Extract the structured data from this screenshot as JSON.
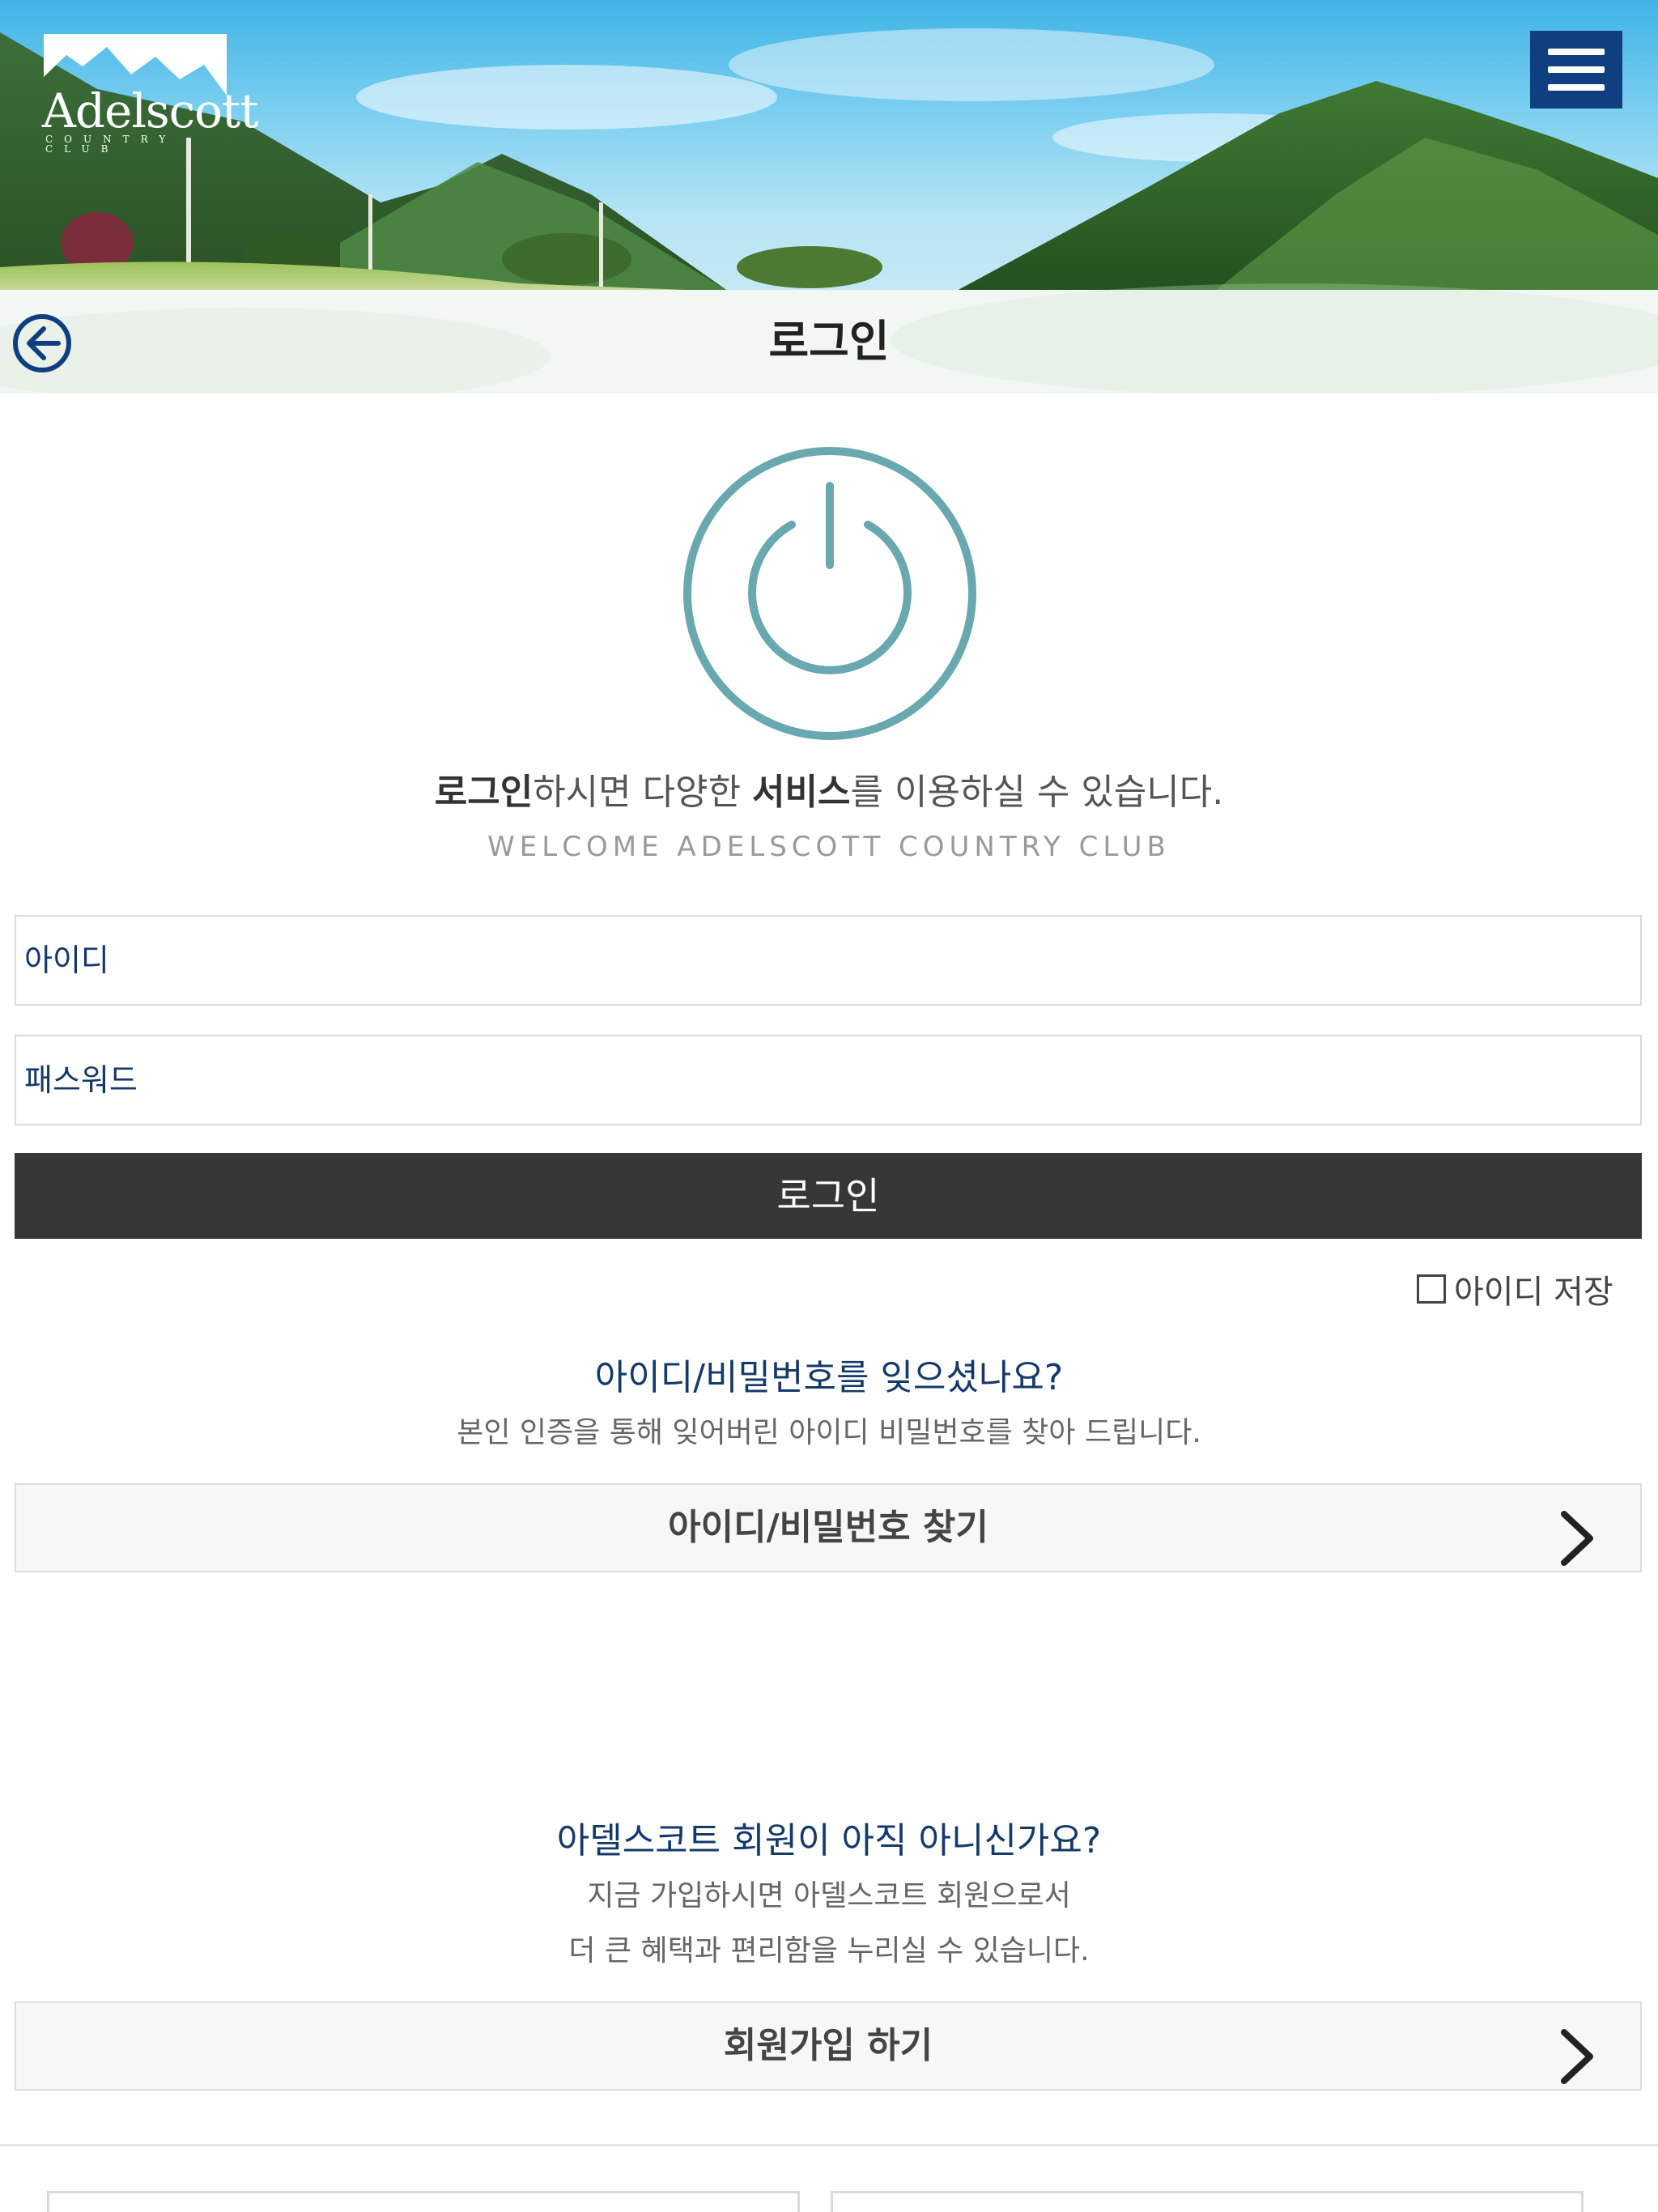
{
  "header": {
    "logo_text": "Adelscott",
    "logo_sub": "COUNTRY CLUB",
    "title": "로그인"
  },
  "intro": {
    "bold1": "로그인",
    "text1": "하시면 다양한 ",
    "bold2": "서비스",
    "text2": "를 이용하실 수 있습니다.",
    "welcome": "WELCOME ADELSCOTT COUNTRY CLUB"
  },
  "form": {
    "id_placeholder": "아이디",
    "pw_placeholder": "패스워드",
    "login_label": "로그인",
    "save_id_label": "아이디 저장",
    "save_id_checked": false
  },
  "find": {
    "title": "아이디/비밀번호를 잊으셨나요?",
    "desc": "본인 인증을 통해 잊어버린 아이디 비밀번호를 찾아 드립니다.",
    "button": "아이디/비밀번호 찾기"
  },
  "join": {
    "title": "아델스코트 회원이 아직 아니신가요?",
    "desc1": "지금 가입하시면 아델스코트 회원으로서",
    "desc2": "더 큰 혜택과 편리함을 누리실 수 있습니다.",
    "button": "회원가입 하기"
  },
  "colors": {
    "accent": "#6aa8b0",
    "navy": "#0f3f80",
    "button_dark": "#373737"
  },
  "icons": [
    "menu-icon",
    "back-arrow-icon",
    "power-icon",
    "chevron-right-icon"
  ]
}
